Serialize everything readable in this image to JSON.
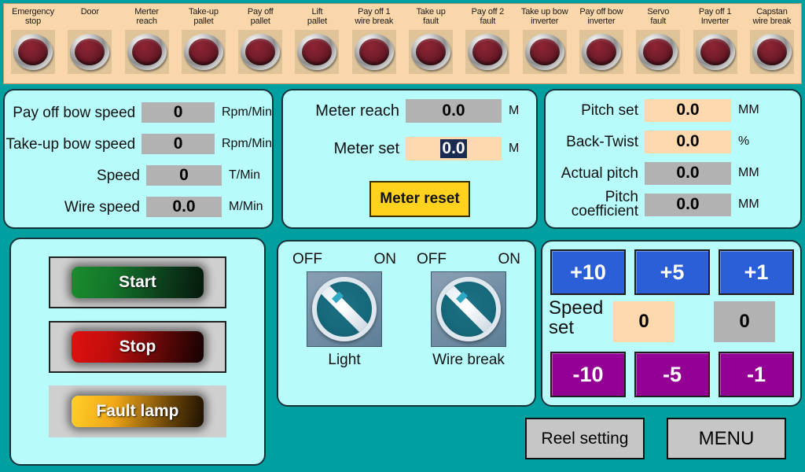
{
  "theme": {
    "background": "#00a0a0",
    "alarm_strip_bg": "#fad7aa",
    "panel_bg": "#b8fbfb",
    "panel_border": "#16333a",
    "value_gray": "#b2b2b2",
    "value_peach": "#ffd9ae",
    "selection_navy": "#1b2a52",
    "plus_blue": "#2a5fd8",
    "minus_purple": "#940094",
    "reset_yellow": "#ffd21e"
  },
  "alarm_indicators": [
    {
      "label": "Emergency\nstop",
      "icon": "indicator-lamp-icon",
      "state": "off"
    },
    {
      "label": "Door",
      "icon": "indicator-lamp-icon",
      "state": "off"
    },
    {
      "label": "Merter\nreach",
      "icon": "indicator-lamp-icon",
      "state": "off"
    },
    {
      "label": "Take-up\npallet",
      "icon": "indicator-lamp-icon",
      "state": "off"
    },
    {
      "label": "Pay off\npallet",
      "icon": "indicator-lamp-icon",
      "state": "off"
    },
    {
      "label": "Lift\npallet",
      "icon": "indicator-lamp-icon",
      "state": "off"
    },
    {
      "label": "Pay off 1\nwire break",
      "icon": "indicator-lamp-icon",
      "state": "off"
    },
    {
      "label": "Take up\nfault",
      "icon": "indicator-lamp-icon",
      "state": "off"
    },
    {
      "label": "Pay off 2\nfault",
      "icon": "indicator-lamp-icon",
      "state": "off"
    },
    {
      "label": "Take up bow\ninverter",
      "icon": "indicator-lamp-icon",
      "state": "off"
    },
    {
      "label": "Pay off bow\ninverter",
      "icon": "indicator-lamp-icon",
      "state": "off"
    },
    {
      "label": "Servo\nfault",
      "icon": "indicator-lamp-icon",
      "state": "off"
    },
    {
      "label": "Pay off 1\nInverter",
      "icon": "indicator-lamp-icon",
      "state": "off"
    },
    {
      "label": "Capstan\nwire break",
      "icon": "indicator-lamp-icon",
      "state": "off"
    }
  ],
  "speed_panel": {
    "rows": [
      {
        "label": "Pay off bow speed",
        "value": "0",
        "unit": "Rpm/Min",
        "field": "readonly"
      },
      {
        "label": "Take-up bow speed",
        "value": "0",
        "unit": "Rpm/Min",
        "field": "readonly"
      },
      {
        "label": "Speed",
        "value": "0",
        "unit": "T/Min",
        "field": "readonly"
      },
      {
        "label": "Wire speed",
        "value": "0.0",
        "unit": "M/Min",
        "field": "readonly"
      }
    ]
  },
  "meter_panel": {
    "reach_label": "Meter reach",
    "reach_value": "0.0",
    "reach_unit": "M",
    "set_label": "Meter set",
    "set_value": "0.0",
    "set_unit": "M",
    "set_selected": true,
    "reset_button": "Meter reset"
  },
  "pitch_panel": {
    "rows": [
      {
        "label": "Pitch set",
        "value": "0.0",
        "unit": "MM",
        "field": "editable"
      },
      {
        "label": "Back-Twist",
        "value": "0.0",
        "unit": "%",
        "field": "editable"
      },
      {
        "label": "Actual pitch",
        "value": "0.0",
        "unit": "MM",
        "field": "readonly"
      },
      {
        "label": "Pitch\ncoefficient",
        "value": "0.0",
        "unit": "MM",
        "field": "readonly"
      }
    ]
  },
  "command_panel": {
    "start": "Start",
    "stop": "Stop",
    "fault_lamp": "Fault lamp"
  },
  "switch_panel": {
    "switches": [
      {
        "name": "Light",
        "off_label": "OFF",
        "on_label": "ON",
        "position": "OFF",
        "icon": "rotary-selector-icon"
      },
      {
        "name": "Wire break",
        "off_label": "OFF",
        "on_label": "ON",
        "position": "OFF",
        "icon": "rotary-selector-icon"
      }
    ]
  },
  "speed_set_panel": {
    "label": "Speed\nset",
    "plus_buttons": [
      "+10",
      "+5",
      "+1"
    ],
    "minus_buttons": [
      "-10",
      "-5",
      "-1"
    ],
    "setpoint_value": "0",
    "actual_value": "0"
  },
  "nav": {
    "reel_setting": "Reel setting",
    "menu": "MENU"
  }
}
